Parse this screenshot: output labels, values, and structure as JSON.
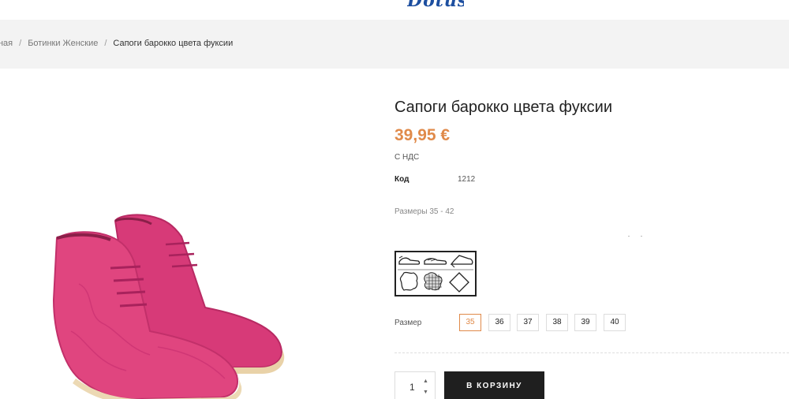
{
  "logo": {
    "text": "Dotus"
  },
  "breadcrumb": {
    "items": [
      "авная",
      "Ботинки Женские",
      "Сапоги барокко цвета фуксии"
    ],
    "separator": "/"
  },
  "product": {
    "title": "Сапоги барокко цвета фуксии",
    "price": "39,95 €",
    "vat_note": "С НДС",
    "code_label": "Код",
    "code_value": "1212",
    "sizes_note": "Размеры 35 - 42",
    "image_icon": "pink-suede-ankle-boots-image",
    "care_icon": "material-care-pictograms-icon",
    "accent_color": "#e08a4a",
    "shoe_color": "#e0457f"
  },
  "size_selector": {
    "label": "Размер",
    "options": [
      "35",
      "36",
      "37",
      "38",
      "39",
      "40"
    ],
    "selected": "35"
  },
  "cart": {
    "quantity": "1",
    "button_label": "В КОРЗИНУ"
  }
}
